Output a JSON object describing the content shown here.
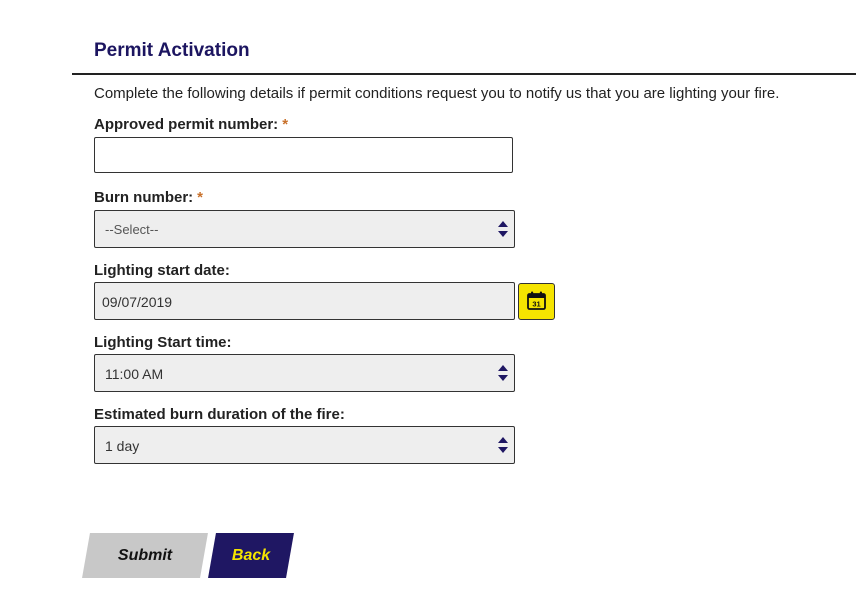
{
  "form": {
    "title": "Permit Activation",
    "intro": "Complete the following details if permit conditions request you to notify us that you are lighting your fire.",
    "required_mark": "*",
    "permit_number": {
      "label": "Approved permit number:",
      "value": ""
    },
    "burn_number": {
      "label": "Burn number:",
      "value": "--Select--"
    },
    "lighting_start_date": {
      "label": "Lighting start date:",
      "value": "09/07/2019",
      "calendar_icon": "calendar-icon",
      "calendar_day": "31"
    },
    "lighting_start_time": {
      "label": "Lighting Start time:",
      "value": "11:00 AM"
    },
    "burn_duration": {
      "label": "Estimated burn duration of the fire:",
      "value": "1 day"
    }
  },
  "actions": {
    "submit_label": "Submit",
    "back_label": "Back"
  },
  "colors": {
    "title": "#1c1560",
    "required": "#c8702a",
    "back_button_bg": "#1f1763",
    "back_button_text": "#f5e400",
    "submit_button_bg": "#c8c8c8",
    "calendar_button_bg": "#f5e400"
  }
}
